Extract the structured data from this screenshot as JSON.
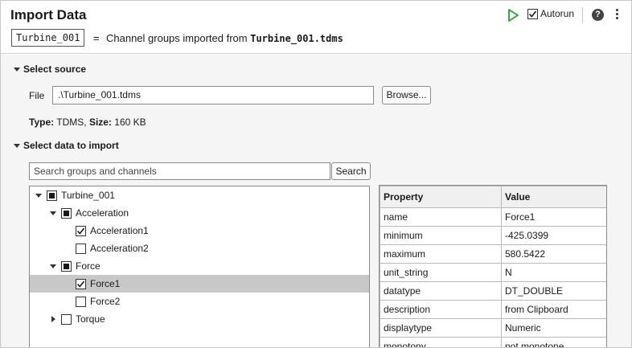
{
  "header": {
    "title": "Import Data",
    "variable_name": "Turbine_001",
    "equals": "=",
    "description_prefix": "Channel groups imported from",
    "description_file": "Turbine_001.tdms",
    "autorun_label": "Autorun",
    "autorun_checked": true,
    "help_symbol": "?"
  },
  "select_source": {
    "heading": "Select source",
    "file_label": "File",
    "file_value": ".\\Turbine_001.tdms",
    "browse_label": "Browse...",
    "type_label": "Type:",
    "type_value": "TDMS,",
    "size_label": "Size:",
    "size_value": "160 KB"
  },
  "select_data": {
    "heading": "Select data to import",
    "search_placeholder": "Search groups and channels",
    "search_button": "Search",
    "tree": [
      {
        "label": "Turbine_001",
        "level": 0,
        "expander": "expanded",
        "state": "partial",
        "selected": false
      },
      {
        "label": "Acceleration",
        "level": 1,
        "expander": "expanded",
        "state": "partial",
        "selected": false
      },
      {
        "label": "Acceleration1",
        "level": 2,
        "expander": "none",
        "state": "checked",
        "selected": false
      },
      {
        "label": "Acceleration2",
        "level": 2,
        "expander": "none",
        "state": "unchecked",
        "selected": false
      },
      {
        "label": "Force",
        "level": 1,
        "expander": "expanded",
        "state": "partial",
        "selected": false
      },
      {
        "label": "Force1",
        "level": 2,
        "expander": "none",
        "state": "checked",
        "selected": true
      },
      {
        "label": "Force2",
        "level": 2,
        "expander": "none",
        "state": "unchecked",
        "selected": false
      },
      {
        "label": "Torque",
        "level": 1,
        "expander": "collapsed",
        "state": "unchecked",
        "selected": false
      }
    ],
    "properties": {
      "headers": [
        "Property",
        "Value"
      ],
      "rows": [
        [
          "name",
          "Force1"
        ],
        [
          "minimum",
          "-425.0399"
        ],
        [
          "maximum",
          "580.5422"
        ],
        [
          "unit_string",
          "N"
        ],
        [
          "datatype",
          "DT_DOUBLE"
        ],
        [
          "description",
          "from Clipboard"
        ],
        [
          "displaytype",
          "Numeric"
        ],
        [
          "monotony",
          "not monotone"
        ]
      ]
    }
  },
  "colors": {
    "run_green": "#2ca02c",
    "selection_gray": "#c8c8c8",
    "panel_bg": "#f5f5f5"
  }
}
